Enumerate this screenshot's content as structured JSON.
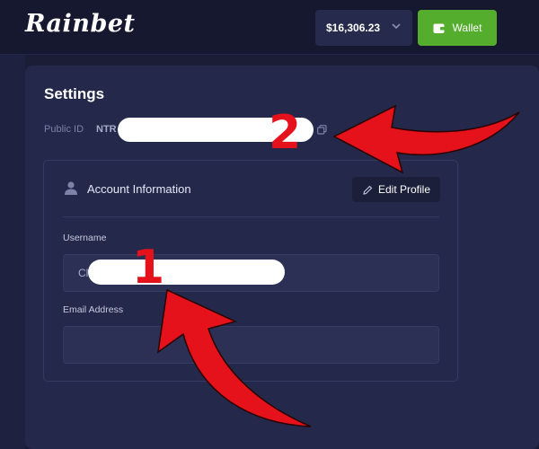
{
  "header": {
    "logo_text": "Rainbet",
    "balance": "$16,306.23",
    "wallet_label": "Wallet"
  },
  "settings": {
    "title": "Settings",
    "public_id_label": "Public ID",
    "public_id_prefix": "NTR",
    "account_section": {
      "title": "Account Information",
      "edit_button_label": "Edit Profile",
      "username_label": "Username",
      "username_value": "Cl",
      "email_label": "Email Address",
      "email_value": ""
    }
  },
  "annotations": {
    "badge_1": "1",
    "badge_2": "2",
    "arrow_color": "#e5121b"
  },
  "colors": {
    "page_bg": "#1b1d36",
    "panel_bg": "#24284a",
    "wallet_green": "#55ad2e"
  },
  "icons": [
    "chevron-down-icon",
    "wallet-icon",
    "copy-icon",
    "user-icon",
    "pencil-icon"
  ]
}
